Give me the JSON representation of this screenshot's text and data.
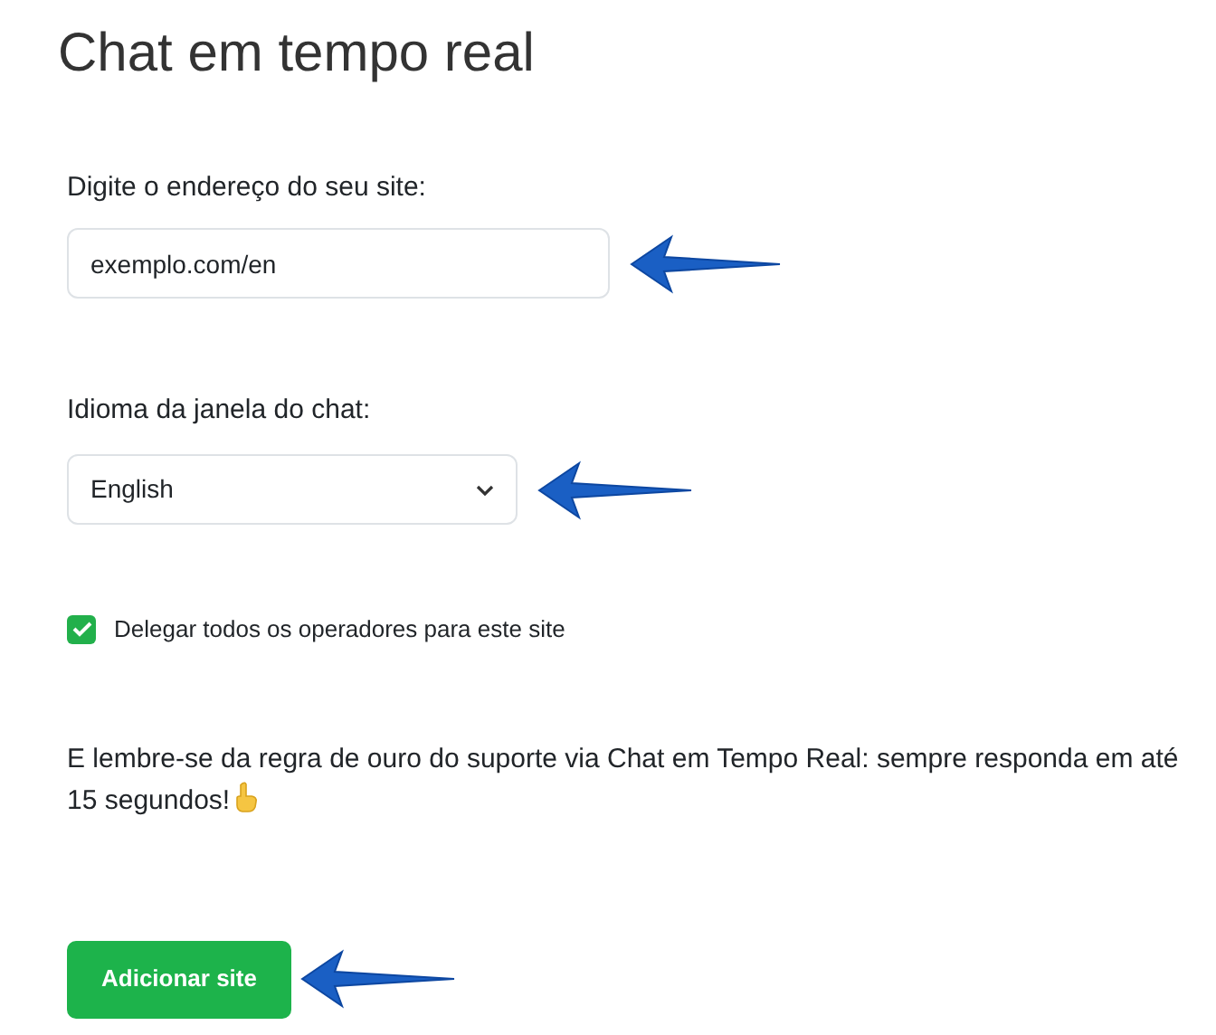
{
  "title": "Chat em tempo real",
  "site_field": {
    "label": "Digite o endereço do seu site:",
    "value": "exemplo.com/en"
  },
  "language_select": {
    "label": "Idioma da janela do chat:",
    "value": "English"
  },
  "delegate_checkbox": {
    "label": "Delegar todos os operadores para este site",
    "checked": true
  },
  "reminder": "E lembre-se da regra de ouro do suporte via Chat em Tempo Real: sempre responda em até 15 segundos!",
  "submit_button": "Adicionar site"
}
